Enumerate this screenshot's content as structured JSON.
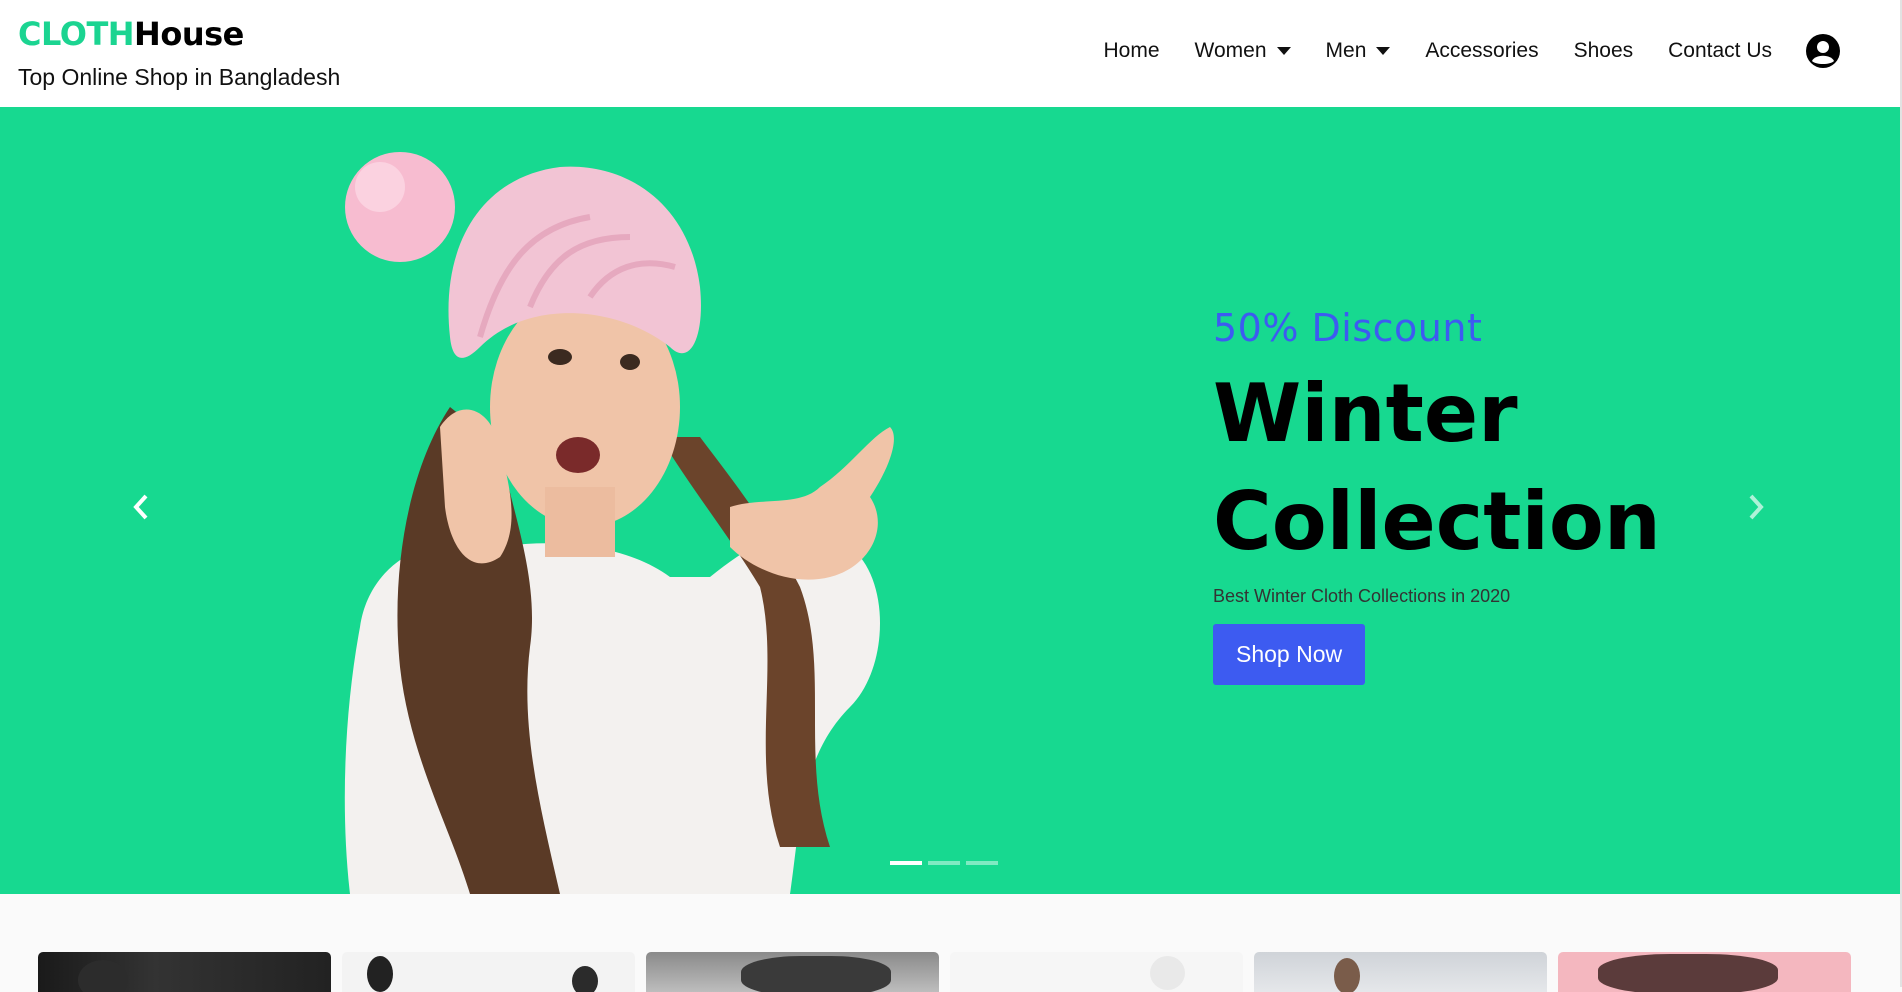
{
  "brand": {
    "part1": "CLOTH",
    "part2": "House",
    "tagline": "Top Online Shop in Bangladesh"
  },
  "nav": {
    "home": "Home",
    "women": "Women",
    "men": "Men",
    "accessories": "Accessories",
    "shoes": "Shoes",
    "contact": "Contact Us",
    "account_icon": "user-circle-icon"
  },
  "hero": {
    "discount": "50% Discount",
    "title_line1": "Winter",
    "title_line2": "Collection",
    "subtitle": "Best Winter Cloth Collections in 2020",
    "button": "Shop Now",
    "slide_count": 3,
    "active_slide": 1
  },
  "colors": {
    "brand_green": "#1bd491",
    "hero_bg": "#17d990",
    "accent_blue": "#3d5bf1"
  }
}
